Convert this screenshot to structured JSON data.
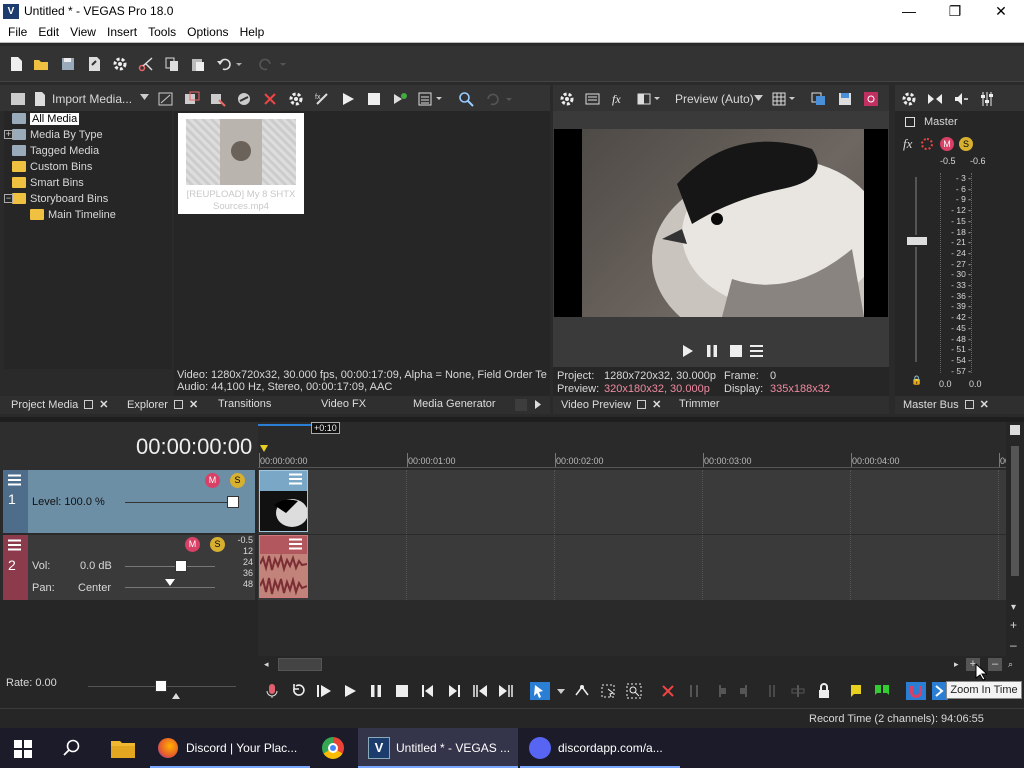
{
  "window": {
    "title": "Untitled * - VEGAS Pro 18.0",
    "logo": "V"
  },
  "menu": [
    "File",
    "Edit",
    "View",
    "Insert",
    "Tools",
    "Options",
    "Help"
  ],
  "project_media": {
    "import_label": "Import Media...",
    "tree": [
      {
        "label": "All Media",
        "selected": true
      },
      {
        "label": "Media By Type"
      },
      {
        "label": "Tagged Media"
      },
      {
        "label": "Custom Bins"
      },
      {
        "label": "Smart Bins"
      },
      {
        "label": "Storyboard Bins"
      },
      {
        "label": "Main Timeline"
      }
    ],
    "thumb_caption": "[REUPLOAD] My 8 SHTX Sources.mp4",
    "video_info": "Video: 1280x720x32, 30.000 fps, 00:00:17:09, Alpha = None, Field Order Te",
    "audio_info": "Audio: 44,100 Hz, Stereo, 00:00:17:09, AAC"
  },
  "docked_tabs": {
    "project_media": "Project Media",
    "explorer": "Explorer",
    "transitions": "Transitions",
    "video_fx": "Video FX",
    "media_generator": "Media Generator",
    "video_preview": "Video Preview",
    "trimmer": "Trimmer",
    "master_bus": "Master Bus"
  },
  "preview": {
    "mode": "Preview (Auto)",
    "project_label": "Project:",
    "project_value": "1280x720x32, 30.000p",
    "frame_label": "Frame:",
    "frame_value": "0",
    "preview_label": "Preview:",
    "preview_value": "320x180x32, 30.000p",
    "display_label": "Display:",
    "display_value": "335x188x32"
  },
  "master": {
    "label": "Master",
    "peak_left": "-0.5",
    "peak_right": "-0.6",
    "scale": [
      "3",
      "6",
      "9",
      "12",
      "15",
      "18",
      "21",
      "24",
      "27",
      "30",
      "33",
      "36",
      "39",
      "42",
      "45",
      "48",
      "51",
      "54",
      "57"
    ],
    "out_left": "0.0",
    "out_right": "0.0"
  },
  "timeline": {
    "timecode": "00:00:00:00",
    "region": "+0:10",
    "ruler": [
      "00:00:00:00",
      "00:00:01:00",
      "00:00:02:00",
      "00:00:03:00",
      "00:00:04:00",
      "00:0"
    ],
    "video_track": {
      "number": "1",
      "level": "Level: 100.0 %"
    },
    "audio_track": {
      "number": "2",
      "vol_label": "Vol:",
      "vol_value": "0.0 dB",
      "pan_label": "Pan:",
      "pan_value": "Center",
      "meter": [
        "-0.5",
        "12",
        "24",
        "36",
        "48"
      ]
    },
    "rate": "Rate: 0.00",
    "tooltip": "Zoom In Time"
  },
  "status": {
    "record_time": "Record Time (2 channels): 94:06:55"
  },
  "taskbar": {
    "items": [
      "Discord | Your Plac...",
      "Untitled * - VEGAS ...",
      "discordapp.com/a..."
    ]
  },
  "colors": {
    "accent": "#2a7fd4",
    "video_track": "#6d8fa6",
    "audio_track": "#8c3b4d",
    "track_bg": "#3a3a3a"
  }
}
